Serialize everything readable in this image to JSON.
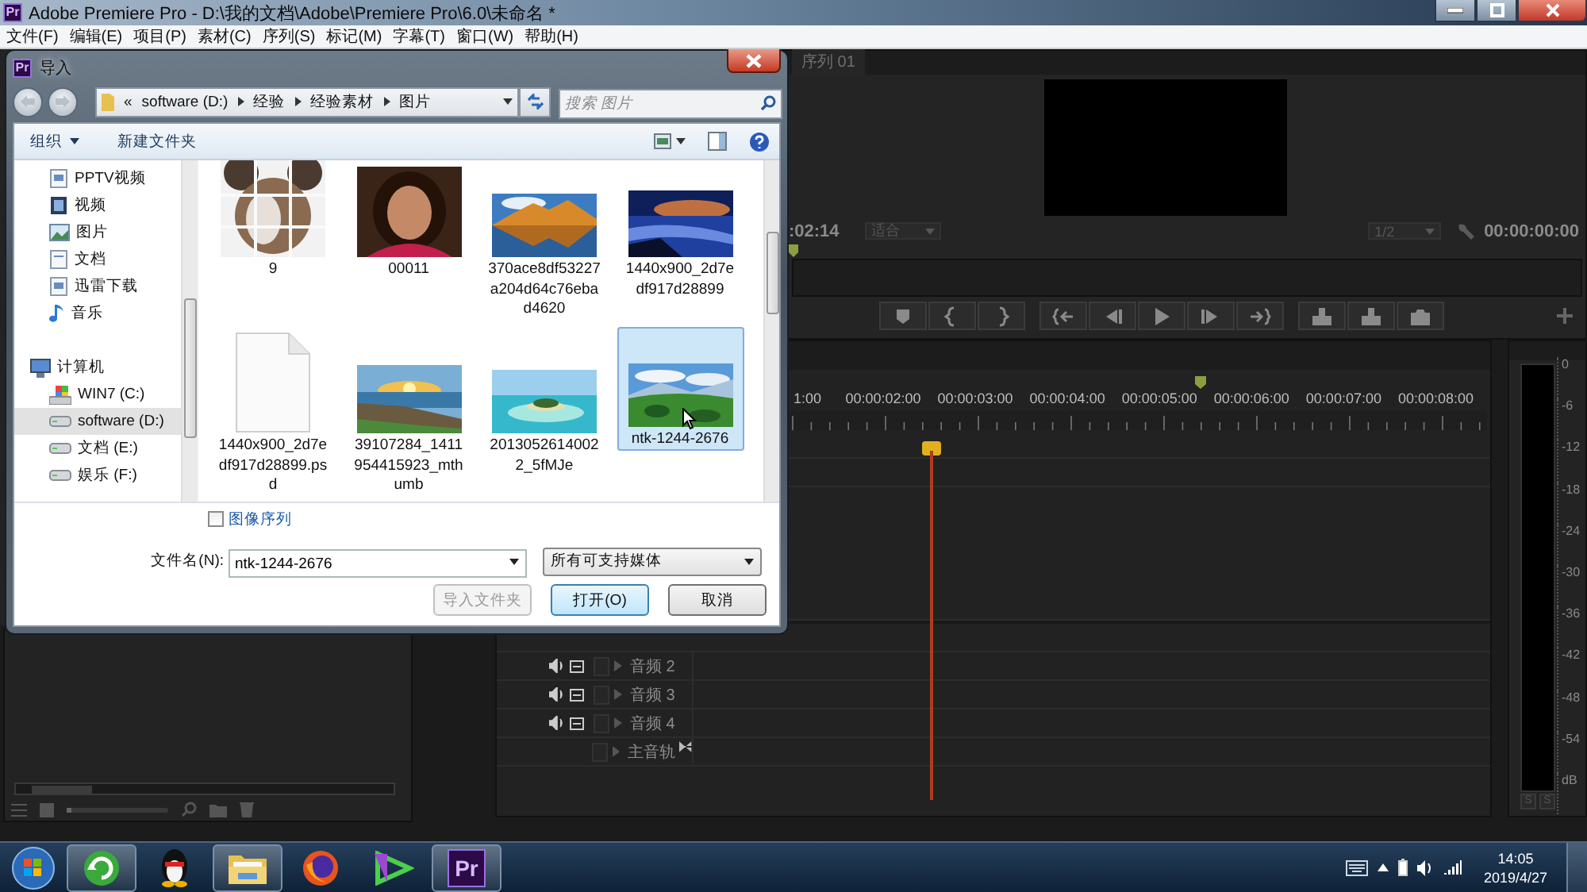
{
  "app": {
    "logo": "Pr",
    "title": "Adobe Premiere Pro - D:\\我的文档\\Adobe\\Premiere Pro\\6.0\\未命名 *"
  },
  "menu": [
    "文件(F)",
    "编辑(E)",
    "项目(P)",
    "素材(C)",
    "序列(S)",
    "标记(M)",
    "字幕(T)",
    "窗口(W)",
    "帮助(H)"
  ],
  "project_panel": {
    "zoom": {
      "level": 0.05
    }
  },
  "program_monitor": {
    "tab": "序列 01",
    "timecode_in": ":02:14",
    "zoom": "适合",
    "resolution": "1/2",
    "timecode_out": "00:00:00:00"
  },
  "timeline": {
    "timecodes": [
      "1:00",
      "00:00:02:00",
      "00:00:03:00",
      "00:00:04:00",
      "00:00:05:00",
      "00:00:06:00",
      "00:00:07:00",
      "00:00:08:00"
    ],
    "tracks": [
      {
        "name": "音频 2",
        "kind": "audio"
      },
      {
        "name": "音频 3",
        "kind": "audio"
      },
      {
        "name": "音频 4",
        "kind": "audio"
      },
      {
        "name": "主音轨",
        "kind": "master"
      }
    ]
  },
  "audio_meter": {
    "scale": [
      "0",
      "-6",
      "-12",
      "-18",
      "-24",
      "-30",
      "-36",
      "-42",
      "-48",
      "-54",
      "dB"
    ],
    "buttons": [
      "S",
      "S"
    ]
  },
  "dialog": {
    "logo": "Pr",
    "title": "导入",
    "overflow": "«",
    "breadcrumb": [
      "software (D:)",
      "经验",
      "经验素材",
      "图片"
    ],
    "search": {
      "placeholder": "搜索 图片"
    },
    "toolbar": [
      {
        "label": "组织",
        "kind": "menu"
      },
      {
        "label": "新建文件夹",
        "kind": "action"
      }
    ],
    "nav": {
      "libraries": [
        {
          "label": "PPTV视频",
          "kind": "pptv",
          "selected": false
        },
        {
          "label": "视频",
          "kind": "video",
          "selected": false
        },
        {
          "label": "图片",
          "kind": "pictures",
          "selected": false
        },
        {
          "label": "文档",
          "kind": "documents",
          "selected": false
        },
        {
          "label": "迅雷下载",
          "kind": "downloads",
          "selected": false
        },
        {
          "label": "音乐",
          "kind": "music",
          "selected": false
        }
      ],
      "computer": {
        "label": "计算机",
        "children": [
          {
            "label": "WIN7 (C:)",
            "kind": "system",
            "selected": false
          },
          {
            "label": "software (D:)",
            "kind": "drive",
            "selected": true
          },
          {
            "label": "文档 (E:)",
            "kind": "drive",
            "selected": false
          },
          {
            "label": "娱乐 (F:)",
            "kind": "drive",
            "selected": false
          }
        ]
      }
    },
    "files": [
      {
        "name": "9",
        "kind": "picture",
        "selected": false
      },
      {
        "name": "00011",
        "kind": "picture",
        "selected": false
      },
      {
        "name": "370ace8df53227a204d64c76ebad4620",
        "kind": "picture",
        "selected": false
      },
      {
        "name": "1440x900_2d7edf917d28899",
        "kind": "picture",
        "selected": false
      },
      {
        "name": "1440x900_2d7edf917d28899.psd",
        "kind": "document",
        "selected": false
      },
      {
        "name": "39107284_1411954415923_mthumb",
        "kind": "picture",
        "selected": false
      },
      {
        "name": "20130526140022_5fMJe",
        "kind": "picture",
        "selected": false
      },
      {
        "name": "ntk-1244-2676",
        "kind": "picture",
        "selected": true
      }
    ],
    "image_sequence": {
      "label": "图像序列",
      "checked": false
    },
    "filename": {
      "label": "文件名(N):",
      "value": "ntk-1244-2676"
    },
    "filter": "所有可支持媒体",
    "buttons": [
      {
        "label": "导入文件夹",
        "disabled": true,
        "default": false
      },
      {
        "label": "打开(O)",
        "disabled": false,
        "default": true
      },
      {
        "label": "取消",
        "disabled": false,
        "default": false
      }
    ]
  },
  "taskbar": {
    "apps": [
      {
        "kind": "refresh",
        "running": true
      },
      {
        "kind": "penguin",
        "running": false
      },
      {
        "kind": "folder",
        "running": true
      },
      {
        "kind": "globe",
        "running": false
      },
      {
        "kind": "player",
        "running": false
      },
      {
        "kind": "pr",
        "label": "Pr",
        "running": true
      }
    ],
    "time": "14:05",
    "date": "2019/4/27"
  }
}
